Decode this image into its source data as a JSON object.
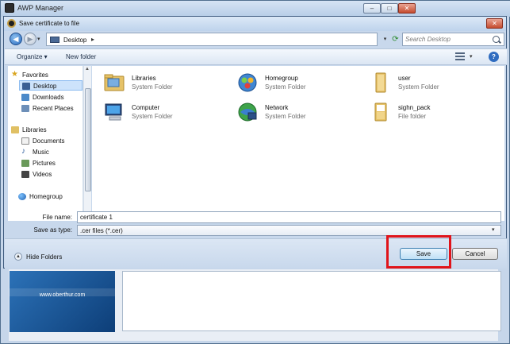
{
  "background_window": {
    "title": "AWP Manager",
    "banner_url": "www.oberthur.com"
  },
  "dialog": {
    "title": "Save certificate to file",
    "address": {
      "location": "Desktop",
      "separator": "▸"
    },
    "search": {
      "placeholder": "Search Desktop"
    },
    "toolbar": {
      "organize_label": "Organize ▾",
      "new_folder_label": "New folder",
      "help_glyph": "?"
    },
    "nav_pane": {
      "items": [
        {
          "label": "Favorites",
          "icon": "star-icon"
        },
        {
          "label": "Desktop",
          "icon": "desktop-icon",
          "selected": true
        },
        {
          "label": "Downloads",
          "icon": "downloads-icon"
        },
        {
          "label": "Recent Places",
          "icon": "recent-places-icon"
        },
        {
          "label": "Libraries",
          "icon": "libraries-icon"
        },
        {
          "label": "Documents",
          "icon": "documents-icon"
        },
        {
          "label": "Music",
          "icon": "music-icon"
        },
        {
          "label": "Pictures",
          "icon": "pictures-icon"
        },
        {
          "label": "Videos",
          "icon": "videos-icon"
        },
        {
          "label": "Homegroup",
          "icon": "homegroup-icon"
        }
      ]
    },
    "files": [
      {
        "name": "Libraries",
        "type": "System Folder",
        "icon": "libraries-folder-icon"
      },
      {
        "name": "Homegroup",
        "type": "System Folder",
        "icon": "homegroup-icon"
      },
      {
        "name": "user",
        "type": "System Folder",
        "icon": "user-folder-icon"
      },
      {
        "name": "Computer",
        "type": "System Folder",
        "icon": "computer-icon"
      },
      {
        "name": "Network",
        "type": "System Folder",
        "icon": "network-icon"
      },
      {
        "name": "sighn_pack",
        "type": "File folder",
        "icon": "folder-icon"
      }
    ],
    "file_name": {
      "label": "File name:",
      "value": "certificate 1"
    },
    "save_as_type": {
      "label": "Save as type:",
      "value": ".cer files (*.cer)"
    },
    "hide_folders_label": "Hide Folders",
    "save_label": "Save",
    "cancel_label": "Cancel"
  },
  "colors": {
    "desktop_background": "#1d4f95",
    "highlight_annotation": "#e0141a",
    "selection": "#cde3fb"
  }
}
